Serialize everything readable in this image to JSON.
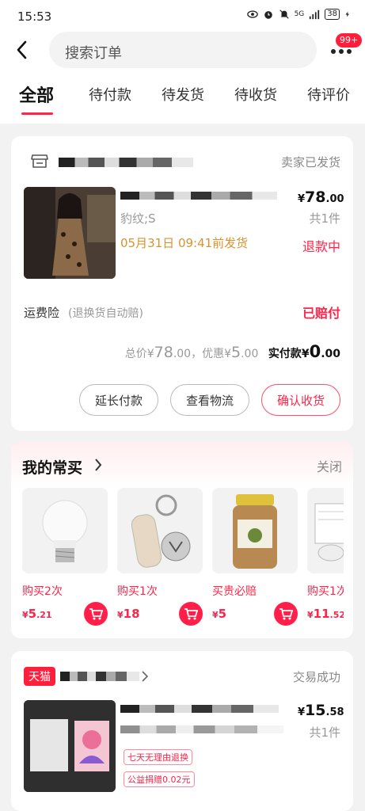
{
  "status_bar": {
    "time": "15:53",
    "battery": "38",
    "signal_label": "5G"
  },
  "header": {
    "search_placeholder": "搜索订单",
    "badge": "99+"
  },
  "tabs": [
    {
      "label": "全部"
    },
    {
      "label": "待付款"
    },
    {
      "label": "待发货"
    },
    {
      "label": "待收货"
    },
    {
      "label": "待评价"
    }
  ],
  "order1": {
    "status": "卖家已发货",
    "price_symbol": "¥",
    "price_int": "78",
    "price_dec": ".00",
    "variant": "豹纹;S",
    "ship_note": "05月31日 09:41前发货",
    "quantity": "共1件",
    "refund_status": "退款中",
    "insurance_label": "运费险",
    "insurance_sub": "(退换货自动赔)",
    "insurance_status": "已赔付",
    "total_prefix": "总价",
    "total_symbol": "¥",
    "total_int": "78",
    "total_dec": ".00",
    "discount_prefix": "，优惠",
    "discount_symbol": "¥",
    "discount_int": "5",
    "discount_dec": ".00",
    "paid_prefix": "实付款",
    "paid_symbol": "¥",
    "paid_int": "0",
    "paid_dec": ".00",
    "buttons": [
      "延长付款",
      "查看物流",
      "确认收货"
    ]
  },
  "favorites": {
    "title": "我的常买",
    "close": "关闭",
    "items": [
      {
        "label": "购买2次",
        "symbol": "¥",
        "price_int": "5",
        "price_dec": ".21"
      },
      {
        "label": "购买1次",
        "symbol": "¥",
        "price_int": "18",
        "price_dec": ""
      },
      {
        "label": "买贵必赔",
        "symbol": "¥",
        "price_int": "5",
        "price_dec": ""
      },
      {
        "label": "购买1次",
        "symbol": "¥",
        "price_int": "11",
        "price_dec": ".52"
      }
    ]
  },
  "order2": {
    "shop_tag": "天猫",
    "status": "交易成功",
    "price_symbol": "¥",
    "price_int": "15",
    "price_dec": ".58",
    "quantity": "共1件",
    "tags": [
      "七天无理由退换",
      "公益捐赠0.02元"
    ]
  },
  "colors": {
    "accent": "#ff2448",
    "shipping_note": "#d9932e",
    "background": "#f2f2f2"
  }
}
